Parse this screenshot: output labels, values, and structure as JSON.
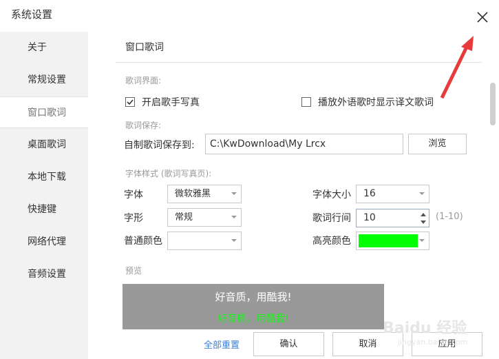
{
  "window": {
    "title": "系统设置",
    "close_icon": "close-icon"
  },
  "sidebar": {
    "items": [
      {
        "label": "关于"
      },
      {
        "label": "常规设置"
      },
      {
        "label": "窗口歌词",
        "active": true
      },
      {
        "label": "桌面歌词"
      },
      {
        "label": "本地下载"
      },
      {
        "label": "快捷键"
      },
      {
        "label": "网络代理"
      },
      {
        "label": "音频设置"
      }
    ]
  },
  "main": {
    "section_title": "窗口歌词",
    "lyrics_ui": {
      "label": "歌词界面:",
      "enable_singer_photo": {
        "label": "开启歌手写真",
        "checked": true
      },
      "show_translation": {
        "label": "播放外语歌时显示译文歌词",
        "checked": false
      }
    },
    "lyrics_save": {
      "label": "歌词保存:",
      "path_label": "自制歌词保存到:",
      "path_value": "C:\\KwDownload\\My Lrcx",
      "browse_button": "浏览"
    },
    "font_style": {
      "label": "字体样式 (歌词写真页):",
      "font_label": "字体",
      "font_value": "微软雅黑",
      "size_label": "字体大小",
      "size_value": "16",
      "shape_label": "字形",
      "shape_value": "常规",
      "line_spacing_label": "歌词行间",
      "line_spacing_value": "10",
      "line_spacing_range": "(1-10)",
      "normal_color_label": "普通颜色",
      "normal_color": "#ffffff",
      "highlight_color_label": "高亮颜色",
      "highlight_color": "#00ff00"
    },
    "preview": {
      "label": "预览",
      "line1": "好音质，用酷我!",
      "line2": "好音质，用酷我!",
      "background": "#999999"
    },
    "footer": {
      "reset_link": "全部重置",
      "confirm_button": "确认",
      "cancel_button": "取消",
      "apply_button": "应用"
    }
  },
  "watermark": {
    "text": "Baidu 经验",
    "sub": "jingyan.baidu.com"
  },
  "annotation_color": "#e83a3a"
}
